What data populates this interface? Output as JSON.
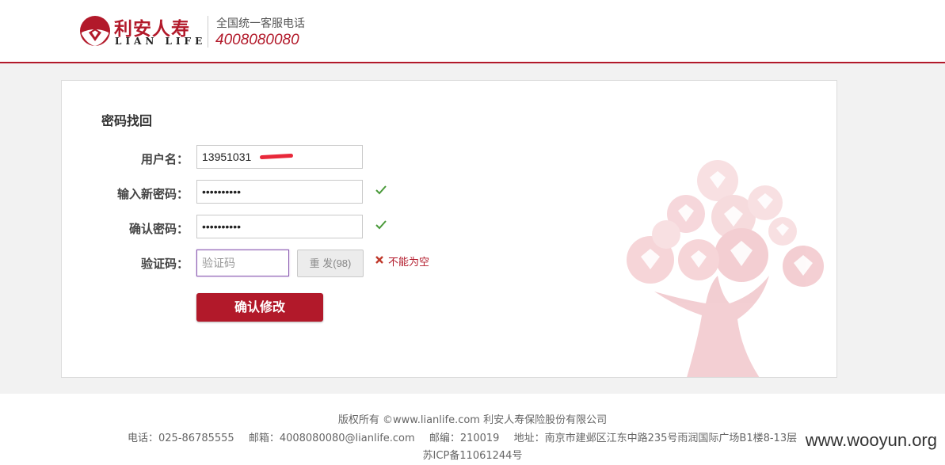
{
  "header": {
    "logo_cn": "利安人寿",
    "logo_en": "LIAN LIFE",
    "hotline_label": "全国统一客服电话",
    "hotline_number": "4008080080"
  },
  "form": {
    "title": "密码找回",
    "username": {
      "label": "用户名：",
      "value": "13951031"
    },
    "new_password": {
      "label": "输入新密码：",
      "value": "••••••••••",
      "status": "valid"
    },
    "confirm_password": {
      "label": "确认密码：",
      "value": "••••••••••",
      "status": "valid"
    },
    "captcha": {
      "label": "验证码：",
      "placeholder": "验证码",
      "resend_label": "重 发(98)",
      "error_text": "不能为空"
    },
    "submit_label": "确认修改"
  },
  "footer": {
    "copyright": "版权所有 ©www.lianlife.com 利安人寿保险股份有限公司",
    "phone": "电话：025-86785555",
    "email": "邮箱：4008080080@lianlife.com",
    "postcode": "邮编：210019",
    "address": "地址：南京市建邺区江东中路235号雨润国际广场B1楼8-13层",
    "icp": "苏ICP备11061244号"
  },
  "watermark": "www.wooyun.org",
  "colors": {
    "brand": "#b2192a",
    "valid": "#4a9a3a",
    "error": "#b2192a"
  }
}
